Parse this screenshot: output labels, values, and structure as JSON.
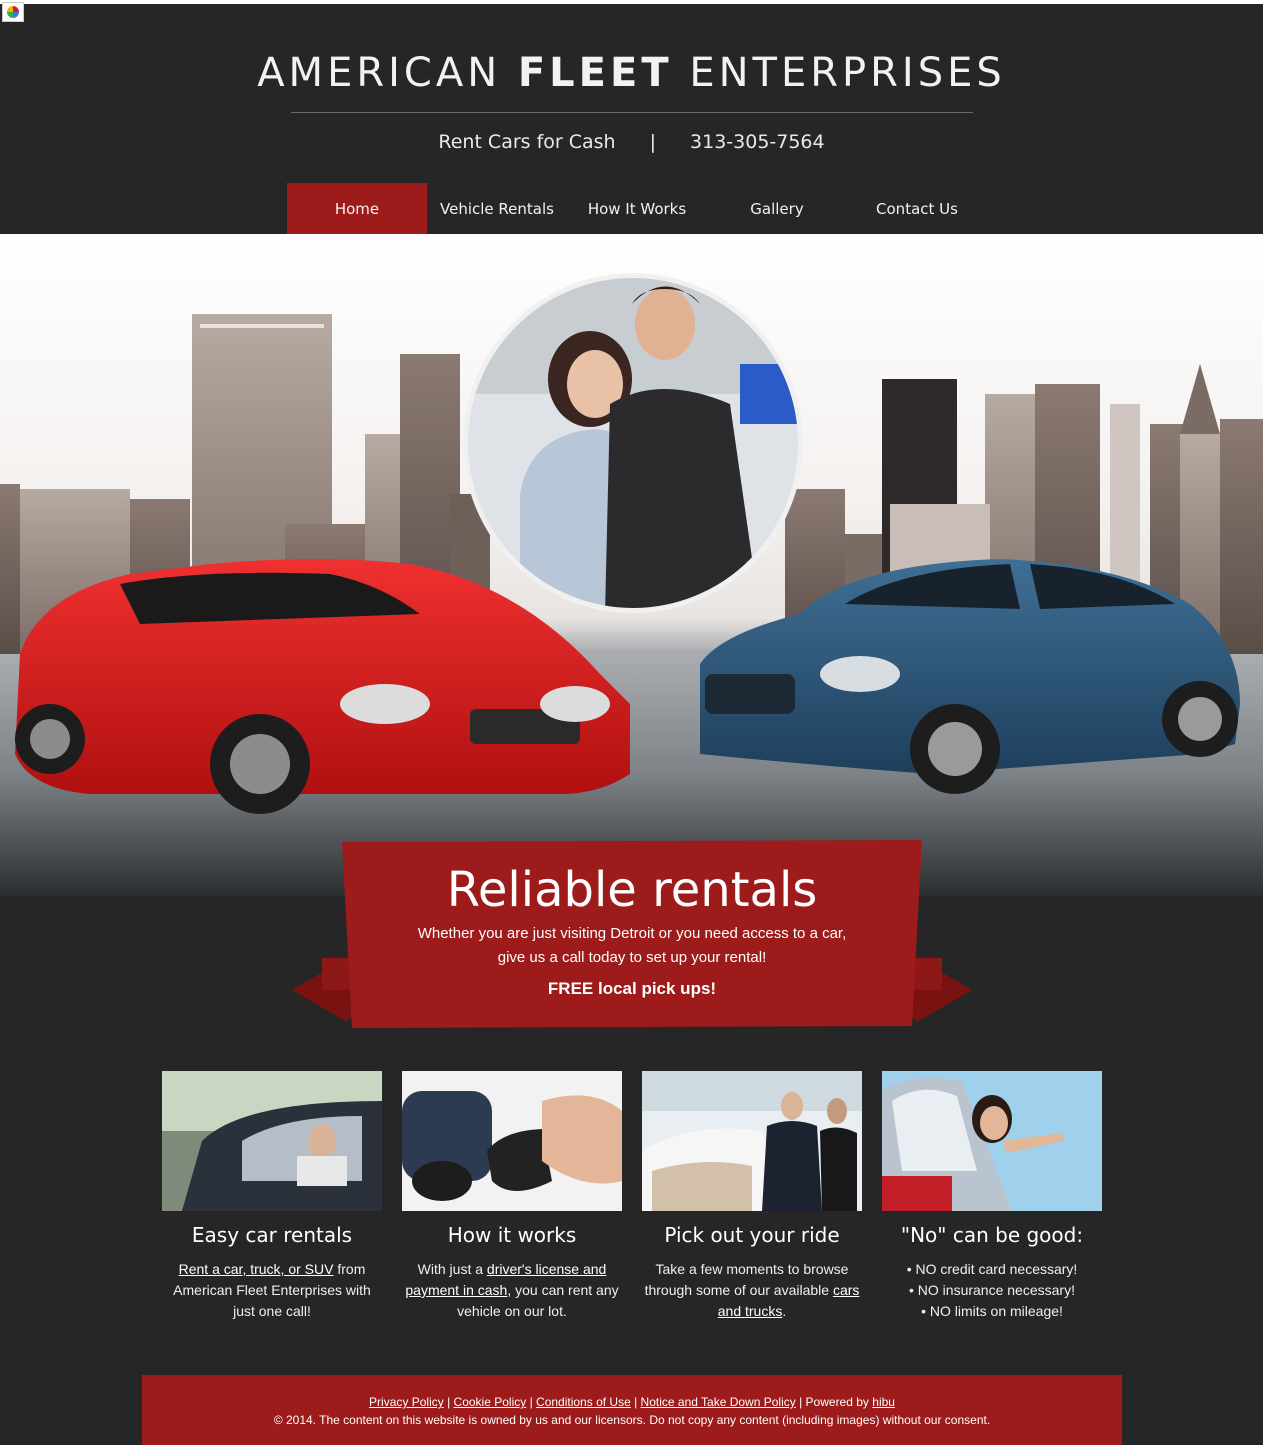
{
  "header": {
    "title_part1": "AMERICAN ",
    "title_part2": "FLEET",
    "title_part3": " ENTERPRISES",
    "tagline_left": "Rent Cars for Cash",
    "tagline_sep": "|",
    "phone": "313-305-7564"
  },
  "nav": {
    "items": [
      {
        "label": "Home",
        "active": true
      },
      {
        "label": "Vehicle Rentals",
        "active": false
      },
      {
        "label": "How It Works",
        "active": false
      },
      {
        "label": "Gallery",
        "active": false
      },
      {
        "label": "Contact Us",
        "active": false
      }
    ]
  },
  "hero": {
    "image": "city-skyline-red-and-blue-cars-couple-with-keys"
  },
  "ribbon": {
    "title": "Reliable rentals",
    "body": "Whether you are just visiting Detroit or you need access to a car, give us a call today to set up your rental!",
    "cta": "FREE local pick ups!"
  },
  "features": [
    {
      "image": "man-driving-car",
      "title": "Easy car rentals",
      "link1": "Rent a car, truck, or SUV",
      "text1": " from American Fleet Enterprises with just one call!"
    },
    {
      "image": "car-key-remote",
      "title": "How it works",
      "text1": "With just a ",
      "link1": "driver's license and payment in cash",
      "text2": ", you can rent any vehicle on our lot."
    },
    {
      "image": "car-showroom-salesmen",
      "title": "Pick out your ride",
      "text1": "Take a few moments to browse through some of our available ",
      "link1": "cars and trucks",
      "text2": "."
    },
    {
      "image": "woman-holding-keys-in-car",
      "title": "\"No\" can be good:",
      "line1": "• NO credit card necessary!",
      "line2": "• NO insurance necessary!",
      "line3": "• NO limits on mileage!"
    }
  ],
  "footer": {
    "link_privacy": "Privacy Policy",
    "link_cookie": "Cookie Policy",
    "link_conditions": "Conditions of Use",
    "link_notice": "Notice and Take Down Policy",
    "powered_by": "Powered by",
    "link_hibu": "hibu",
    "copyright": "© 2014. The content on this website is owned by us and our licensors. Do not copy any content (including images) without our consent."
  },
  "colors": {
    "background": "#262626",
    "accent": "#9d1b1b"
  }
}
